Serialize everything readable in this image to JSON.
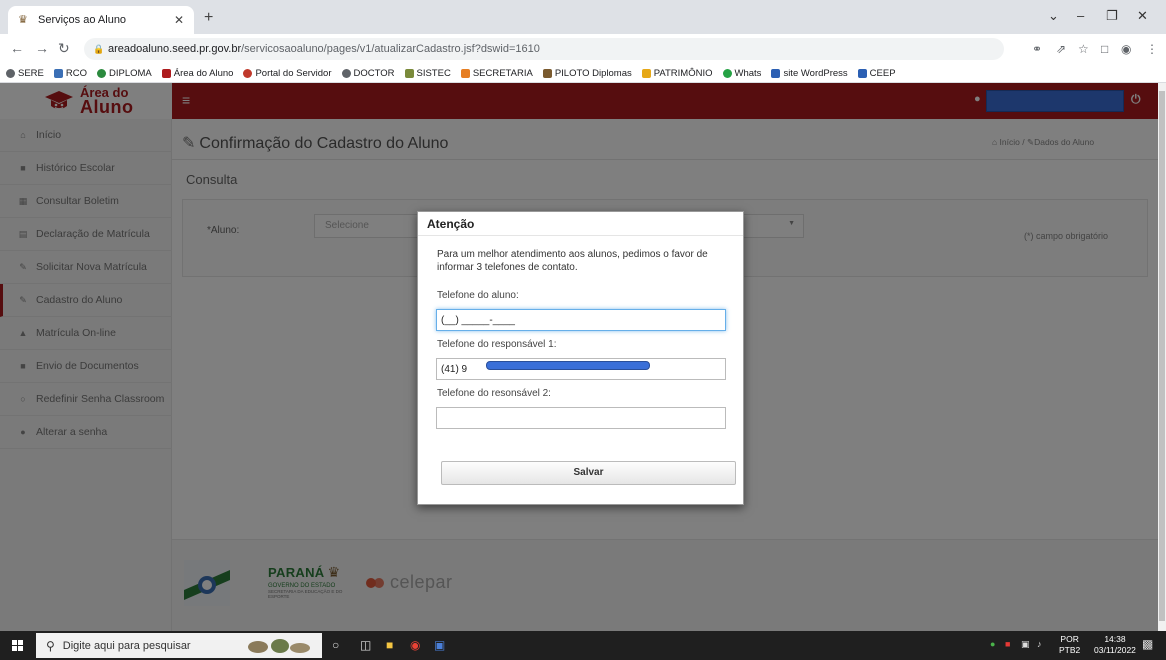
{
  "browser": {
    "tab_title": "Serviços ao Aluno",
    "url_host": "areadoaluno.seed.pr.gov.br",
    "url_path": "/servicosaoaluno/pages/v1/atualizarCadastro.jsf?dswid=1610",
    "bookmarks": [
      "SERE",
      "RCO",
      "DIPLOMA",
      "Área do Aluno",
      "Portal do Servidor",
      "DOCTOR",
      "SISTEC",
      "SECRETARIA",
      "PILOTO Diplomas",
      "PATRIMÔNIO",
      "Whats",
      "site WordPress",
      "CEEP"
    ]
  },
  "app": {
    "logo_line1": "Área do",
    "logo_line2": "Aluno",
    "brand_color": "#ad1b1e"
  },
  "sidebar": {
    "items": [
      {
        "label": "Início",
        "icon": "home-icon"
      },
      {
        "label": "Histórico Escolar",
        "icon": "folder-icon"
      },
      {
        "label": "Consultar Boletim",
        "icon": "grid-icon"
      },
      {
        "label": "Declaração de Matrícula",
        "icon": "document-icon"
      },
      {
        "label": "Solicitar Nova Matrícula",
        "icon": "edit-icon"
      },
      {
        "label": "Cadastro do Aluno",
        "icon": "edit-icon"
      },
      {
        "label": "Matrícula On-line",
        "icon": "graduation-icon"
      },
      {
        "label": "Envio de Documentos",
        "icon": "folder-icon"
      },
      {
        "label": "Redefinir Senha Classroom",
        "icon": "unlock-icon"
      },
      {
        "label": "Alterar a senha",
        "icon": "lock-icon"
      }
    ]
  },
  "main": {
    "title": "Confirmação do Cadastro do Aluno",
    "breadcrumb_home": "Início",
    "breadcrumb_current": "Dados do Aluno",
    "section": "Consulta",
    "required_note": "(*) campo obrigatório",
    "aluno_label": "*Aluno:",
    "aluno_select": "Selecione"
  },
  "footer": {
    "parana_title": "PARANÁ",
    "parana_sub": "GOVERNO DO ESTADO",
    "parana_sub2": "SECRETARIA DA EDUCAÇÃO E DO ESPORTE",
    "celepar": "celepar"
  },
  "modal": {
    "title": "Atenção",
    "message": "Para um melhor atendimento aos alunos, pedimos o favor de informar 3 telefones de contato.",
    "field1_label": "Telefone do aluno:",
    "field1_value": "(__) _____-____",
    "field2_label": "Telefone do responsável 1:",
    "field2_value": "(41) 9",
    "field3_label": "Telefone do resonsável 2:",
    "field3_value": "",
    "save_label": "Salvar"
  },
  "taskbar": {
    "search_placeholder": "Digite aqui para pesquisar",
    "lang1": "POR",
    "lang2": "PTB2",
    "time": "14:38",
    "date": "03/11/2022"
  }
}
